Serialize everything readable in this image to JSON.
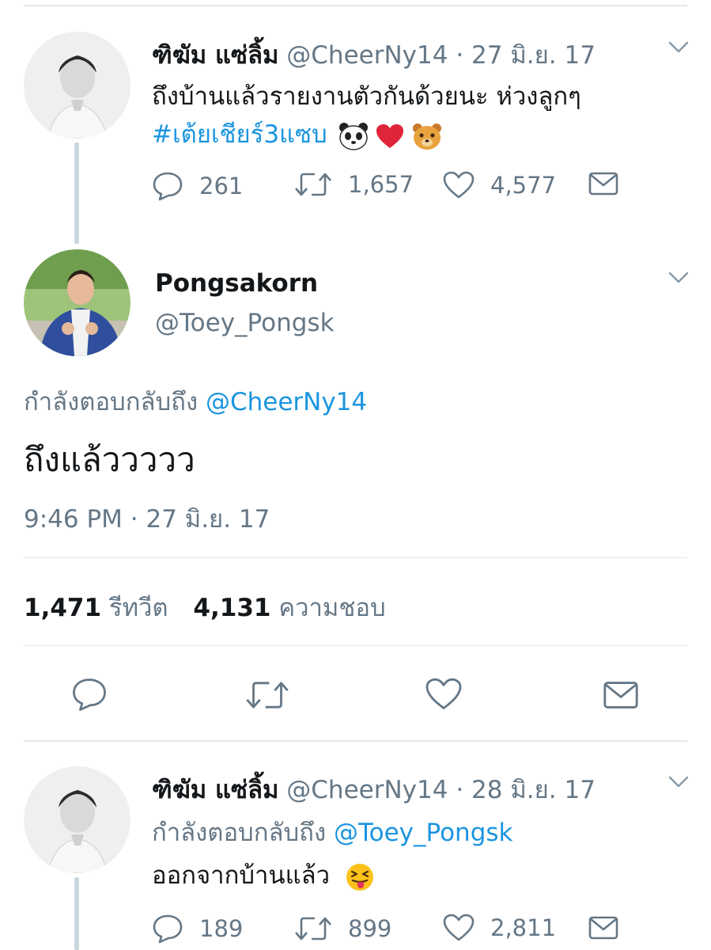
{
  "tweet1": {
    "name": "ฑิฆัม แซ่ลิ้ม",
    "handle": "@CheerNy14",
    "separator": "·",
    "date": "27 มิ.ย. 17",
    "text": "ถึงบ้านแล้วรายงานตัวกันด้วยนะ ห่วงลูกๆ",
    "hashtag": "#เต้ยเชียร์3แซบ",
    "emojis": [
      "panda-face",
      "red-heart",
      "bear-face"
    ],
    "replies": "261",
    "retweets": "1,657",
    "likes": "4,577"
  },
  "main": {
    "name": "Pongsakorn",
    "handle": "@Toey_Pongsk",
    "reply_prefix": "กำลังตอบกลับถึง",
    "reply_to": "@CheerNy14",
    "text": "ถึงแล้ววววว",
    "time": "9:46 PM · 27 มิ.ย. 17",
    "retweet_count": "1,471",
    "retweet_label": "รีทวีต",
    "like_count": "4,131",
    "like_label": "ความชอบ"
  },
  "tweet3": {
    "name": "ฑิฆัม แซ่ลิ้ม",
    "handle": "@CheerNy14",
    "separator": "·",
    "date": "28 มิ.ย. 17",
    "reply_prefix": "กำลังตอบกลับถึง",
    "reply_to": "@Toey_Pongsk",
    "text": "ออกจากบ้านแล้ว",
    "emoji": "squinting-tongue-face",
    "replies": "189",
    "retweets": "899",
    "likes": "2,811"
  },
  "colors": {
    "link": "#1b95e0",
    "muted": "#657786",
    "thread": "#ccd6dd",
    "divider": "#e1e8ed"
  }
}
